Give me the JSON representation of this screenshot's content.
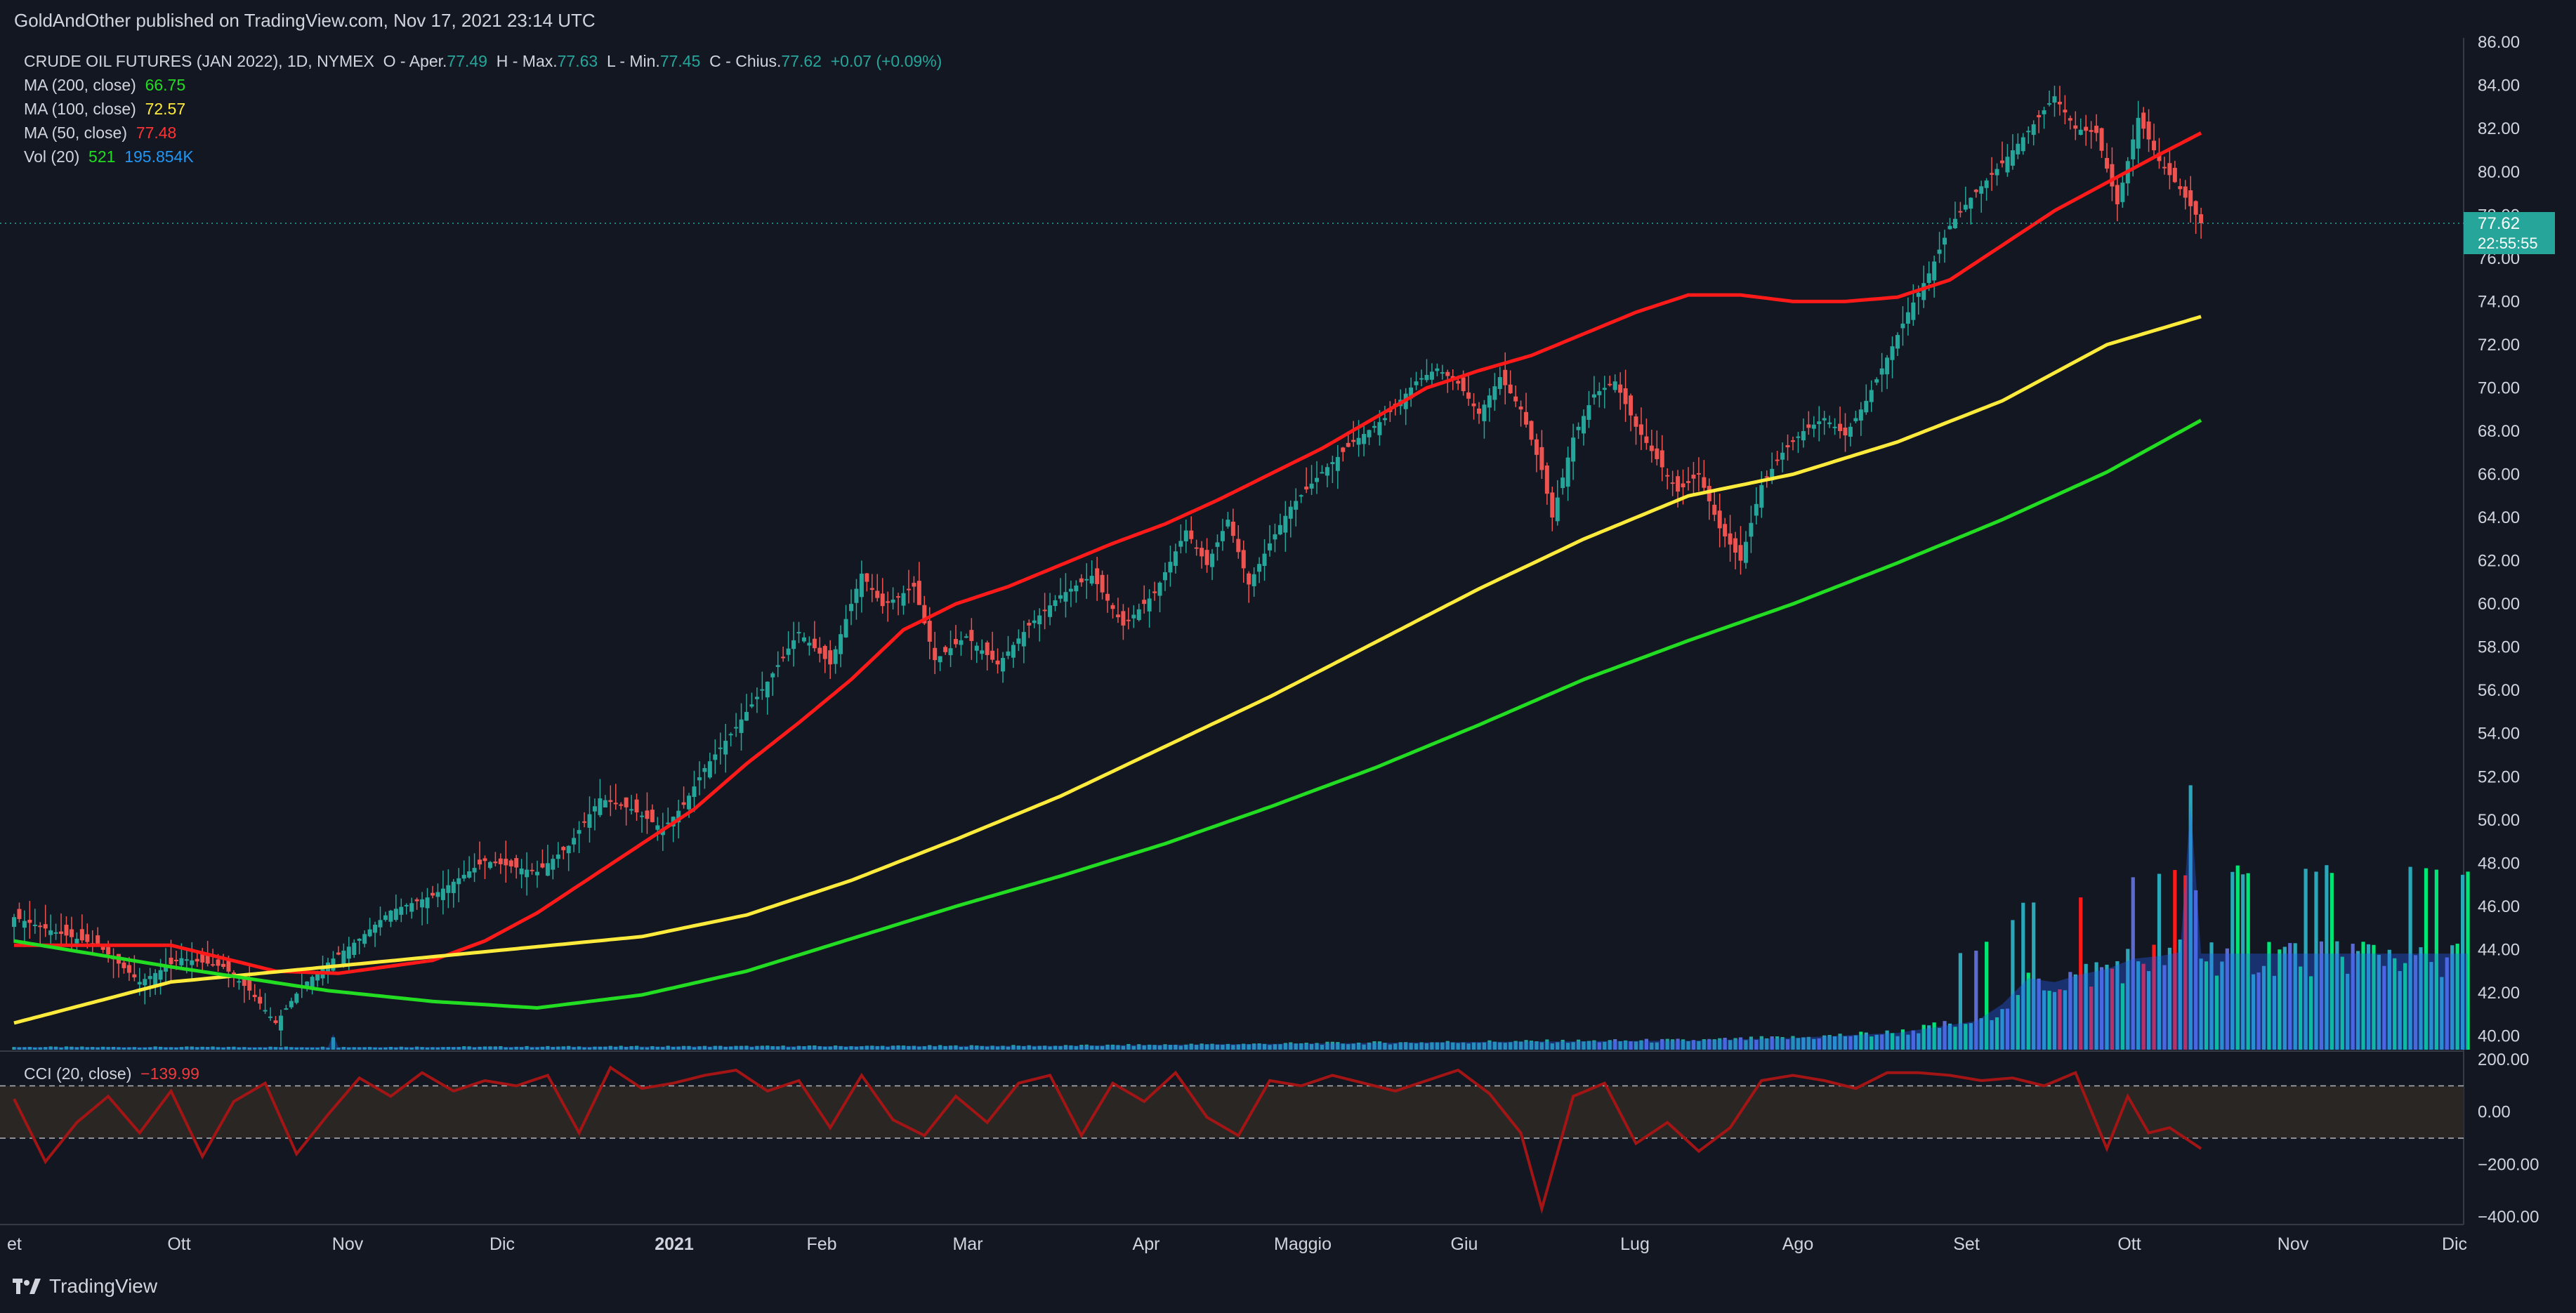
{
  "header": {
    "publisher": "GoldAndOther published on TradingView.com, Nov 17, 2021 23:14 UTC"
  },
  "legend": {
    "symbol": "CRUDE OIL FUTURES (JAN 2022), 1D, NYMEX",
    "o_label": "O - Aper.",
    "o_value": "77.49",
    "h_label": "H - Max.",
    "h_value": "77.63",
    "l_label": "L - Min.",
    "l_value": "77.45",
    "c_label": "C - Chius.",
    "c_value": "77.62",
    "change": "+0.07 (+0.09%)",
    "ma200_label": "MA (200, close)",
    "ma200_value": "66.75",
    "ma200_color": "#22dd22",
    "ma100_label": "MA (100, close)",
    "ma100_value": "72.57",
    "ma100_color": "#ffeb3b",
    "ma50_label": "MA (50, close)",
    "ma50_value": "77.48",
    "ma50_color": "#ff1a1a",
    "vol_label": "Vol (20)",
    "vol_value": "521",
    "vol_ma_value": "195.854K"
  },
  "cci_legend": {
    "label": "CCI (20, close)",
    "value": "−139.99"
  },
  "footer": {
    "brand": "TradingView"
  },
  "chart_data": {
    "type": "candlestick",
    "x_labels": [
      "et",
      "Ott",
      "Nov",
      "Dic",
      "2021",
      "Feb",
      "Mar",
      "Apr",
      "Maggio",
      "Giu",
      "Lug",
      "Ago",
      "Set",
      "Ott",
      "Nov",
      "Dic"
    ],
    "price_axis_ticks": [
      "86.00",
      "84.00",
      "82.00",
      "80.00",
      "78.00",
      "76.00",
      "74.00",
      "72.00",
      "70.00",
      "68.00",
      "66.00",
      "64.00",
      "62.00",
      "60.00",
      "58.00",
      "56.00",
      "54.00",
      "52.00",
      "50.00",
      "48.00",
      "46.00",
      "44.00",
      "42.00",
      "40.00"
    ],
    "ylim": [
      39.3,
      86.2
    ],
    "last_price_label": "77.62",
    "last_price": 77.62,
    "countdown": "22:55:55",
    "price_path": [
      [
        0,
        45.5
      ],
      [
        8,
        44.8
      ],
      [
        16,
        44.2
      ],
      [
        24,
        42.5
      ],
      [
        32,
        43.6
      ],
      [
        40,
        43.2
      ],
      [
        45,
        42.1
      ],
      [
        50,
        40.6
      ],
      [
        55,
        42.3
      ],
      [
        60,
        43.4
      ],
      [
        66,
        44.5
      ],
      [
        72,
        45.8
      ],
      [
        80,
        46.5
      ],
      [
        90,
        48.1
      ],
      [
        100,
        47.6
      ],
      [
        106,
        48.8
      ],
      [
        112,
        51.0
      ],
      [
        118,
        50.5
      ],
      [
        124,
        49.6
      ],
      [
        128,
        50.7
      ],
      [
        132,
        52.4
      ],
      [
        138,
        54.3
      ],
      [
        144,
        56.4
      ],
      [
        150,
        58.7
      ],
      [
        156,
        57.2
      ],
      [
        162,
        61.4
      ],
      [
        166,
        59.9
      ],
      [
        172,
        60.8
      ],
      [
        176,
        57.4
      ],
      [
        182,
        58.5
      ],
      [
        188,
        57.2
      ],
      [
        194,
        59.0
      ],
      [
        200,
        60.4
      ],
      [
        206,
        61.3
      ],
      [
        212,
        59.0
      ],
      [
        218,
        60.5
      ],
      [
        224,
        63.4
      ],
      [
        228,
        61.8
      ],
      [
        232,
        63.9
      ],
      [
        236,
        60.9
      ],
      [
        240,
        62.8
      ],
      [
        244,
        64.5
      ],
      [
        250,
        66.1
      ],
      [
        256,
        67.5
      ],
      [
        262,
        68.6
      ],
      [
        268,
        70.3
      ],
      [
        272,
        70.9
      ],
      [
        276,
        70.2
      ],
      [
        280,
        68.8
      ],
      [
        284,
        70.5
      ],
      [
        288,
        69.0
      ],
      [
        292,
        66.2
      ],
      [
        294,
        64.0
      ],
      [
        298,
        67.7
      ],
      [
        302,
        69.7
      ],
      [
        306,
        70.3
      ],
      [
        310,
        68.2
      ],
      [
        314,
        66.7
      ],
      [
        318,
        65.2
      ],
      [
        322,
        66.0
      ],
      [
        326,
        63.5
      ],
      [
        330,
        62.0
      ],
      [
        334,
        65.5
      ],
      [
        338,
        67.0
      ],
      [
        342,
        68.0
      ],
      [
        346,
        68.6
      ],
      [
        350,
        67.8
      ],
      [
        354,
        69.4
      ],
      [
        358,
        71.4
      ],
      [
        362,
        73.5
      ],
      [
        366,
        75.3
      ],
      [
        370,
        77.5
      ],
      [
        374,
        78.8
      ],
      [
        380,
        80.4
      ],
      [
        386,
        82.2
      ],
      [
        390,
        83.5
      ],
      [
        394,
        82.0
      ],
      [
        398,
        81.8
      ],
      [
        402,
        78.5
      ],
      [
        406,
        82.5
      ],
      [
        410,
        80.5
      ],
      [
        414,
        79.2
      ],
      [
        418,
        77.62
      ]
    ],
    "ma_paths": {
      "MA (50, close)": [
        [
          0,
          44.2
        ],
        [
          30,
          44.2
        ],
        [
          50,
          43.0
        ],
        [
          62,
          42.9
        ],
        [
          80,
          43.5
        ],
        [
          90,
          44.4
        ],
        [
          100,
          45.7
        ],
        [
          110,
          47.3
        ],
        [
          130,
          50.5
        ],
        [
          140,
          52.6
        ],
        [
          150,
          54.5
        ],
        [
          160,
          56.5
        ],
        [
          170,
          58.8
        ],
        [
          180,
          60.0
        ],
        [
          190,
          60.8
        ],
        [
          200,
          61.8
        ],
        [
          210,
          62.8
        ],
        [
          220,
          63.7
        ],
        [
          230,
          64.8
        ],
        [
          240,
          66.0
        ],
        [
          250,
          67.2
        ],
        [
          260,
          68.6
        ],
        [
          270,
          70.0
        ],
        [
          280,
          70.8
        ],
        [
          290,
          71.5
        ],
        [
          300,
          72.5
        ],
        [
          310,
          73.5
        ],
        [
          320,
          74.3
        ],
        [
          330,
          74.3
        ],
        [
          340,
          74.0
        ],
        [
          350,
          74.0
        ],
        [
          360,
          74.2
        ],
        [
          370,
          75.0
        ],
        [
          380,
          76.6
        ],
        [
          390,
          78.2
        ],
        [
          400,
          79.5
        ],
        [
          410,
          80.8
        ],
        [
          418,
          81.8
        ]
      ],
      "MA (100, close)": [
        [
          0,
          40.6
        ],
        [
          30,
          42.5
        ],
        [
          60,
          43.2
        ],
        [
          90,
          43.9
        ],
        [
          120,
          44.6
        ],
        [
          140,
          45.6
        ],
        [
          160,
          47.2
        ],
        [
          180,
          49.1
        ],
        [
          200,
          51.1
        ],
        [
          220,
          53.4
        ],
        [
          240,
          55.7
        ],
        [
          260,
          58.2
        ],
        [
          280,
          60.7
        ],
        [
          300,
          63.0
        ],
        [
          320,
          65.0
        ],
        [
          340,
          66.0
        ],
        [
          360,
          67.5
        ],
        [
          380,
          69.4
        ],
        [
          400,
          72.0
        ],
        [
          418,
          73.3
        ]
      ],
      "MA (200, close)": [
        [
          0,
          44.4
        ],
        [
          30,
          43.2
        ],
        [
          60,
          42.1
        ],
        [
          80,
          41.6
        ],
        [
          100,
          41.3
        ],
        [
          120,
          41.9
        ],
        [
          140,
          43.0
        ],
        [
          160,
          44.5
        ],
        [
          180,
          46.0
        ],
        [
          200,
          47.4
        ],
        [
          220,
          48.9
        ],
        [
          240,
          50.6
        ],
        [
          260,
          52.4
        ],
        [
          280,
          54.4
        ],
        [
          300,
          56.5
        ],
        [
          320,
          58.3
        ],
        [
          340,
          60.0
        ],
        [
          360,
          61.9
        ],
        [
          380,
          63.9
        ],
        [
          400,
          66.1
        ],
        [
          418,
          68.5
        ]
      ]
    },
    "volume_profile": [
      [
        0,
        0.02
      ],
      [
        60,
        0.02
      ],
      [
        61,
        0.12
      ],
      [
        62,
        0.02
      ],
      [
        200,
        0.03
      ],
      [
        280,
        0.06
      ],
      [
        320,
        0.07
      ],
      [
        340,
        0.09
      ],
      [
        360,
        0.13
      ],
      [
        375,
        0.22
      ],
      [
        380,
        0.35
      ],
      [
        385,
        0.55
      ],
      [
        390,
        0.52
      ],
      [
        395,
        0.58
      ],
      [
        400,
        0.62
      ],
      [
        405,
        0.7
      ],
      [
        410,
        0.72
      ],
      [
        414,
        0.75
      ],
      [
        416,
        1.9
      ],
      [
        418,
        0.74
      ]
    ],
    "cci": {
      "label": "CCI (20, close)",
      "axis_ticks": [
        "200.00",
        "0.00",
        "−200.00",
        "−400.00"
      ],
      "bands": [
        100,
        -100
      ],
      "ylim": [
        -430,
        230
      ],
      "values": [
        [
          0,
          50
        ],
        [
          6,
          -190
        ],
        [
          12,
          -40
        ],
        [
          18,
          60
        ],
        [
          24,
          -80
        ],
        [
          30,
          80
        ],
        [
          36,
          -170
        ],
        [
          42,
          40
        ],
        [
          48,
          110
        ],
        [
          54,
          -160
        ],
        [
          60,
          -10
        ],
        [
          66,
          130
        ],
        [
          72,
          60
        ],
        [
          78,
          150
        ],
        [
          84,
          80
        ],
        [
          90,
          120
        ],
        [
          96,
          100
        ],
        [
          102,
          140
        ],
        [
          108,
          -80
        ],
        [
          114,
          170
        ],
        [
          120,
          90
        ],
        [
          126,
          110
        ],
        [
          132,
          140
        ],
        [
          138,
          160
        ],
        [
          144,
          80
        ],
        [
          150,
          120
        ],
        [
          156,
          -60
        ],
        [
          162,
          140
        ],
        [
          168,
          -30
        ],
        [
          174,
          -90
        ],
        [
          180,
          60
        ],
        [
          186,
          -40
        ],
        [
          192,
          110
        ],
        [
          198,
          140
        ],
        [
          204,
          -90
        ],
        [
          210,
          110
        ],
        [
          216,
          40
        ],
        [
          222,
          150
        ],
        [
          228,
          -20
        ],
        [
          234,
          -90
        ],
        [
          240,
          120
        ],
        [
          246,
          100
        ],
        [
          252,
          140
        ],
        [
          258,
          110
        ],
        [
          264,
          80
        ],
        [
          270,
          120
        ],
        [
          276,
          160
        ],
        [
          282,
          70
        ],
        [
          288,
          -80
        ],
        [
          292,
          -370
        ],
        [
          298,
          60
        ],
        [
          304,
          110
        ],
        [
          310,
          -120
        ],
        [
          316,
          -40
        ],
        [
          322,
          -150
        ],
        [
          328,
          -60
        ],
        [
          334,
          120
        ],
        [
          340,
          140
        ],
        [
          346,
          120
        ],
        [
          352,
          90
        ],
        [
          358,
          150
        ],
        [
          364,
          150
        ],
        [
          370,
          140
        ],
        [
          376,
          120
        ],
        [
          382,
          130
        ],
        [
          388,
          100
        ],
        [
          394,
          150
        ],
        [
          400,
          -140
        ],
        [
          404,
          60
        ],
        [
          408,
          -80
        ],
        [
          412,
          -60
        ],
        [
          418,
          -140
        ]
      ]
    }
  }
}
